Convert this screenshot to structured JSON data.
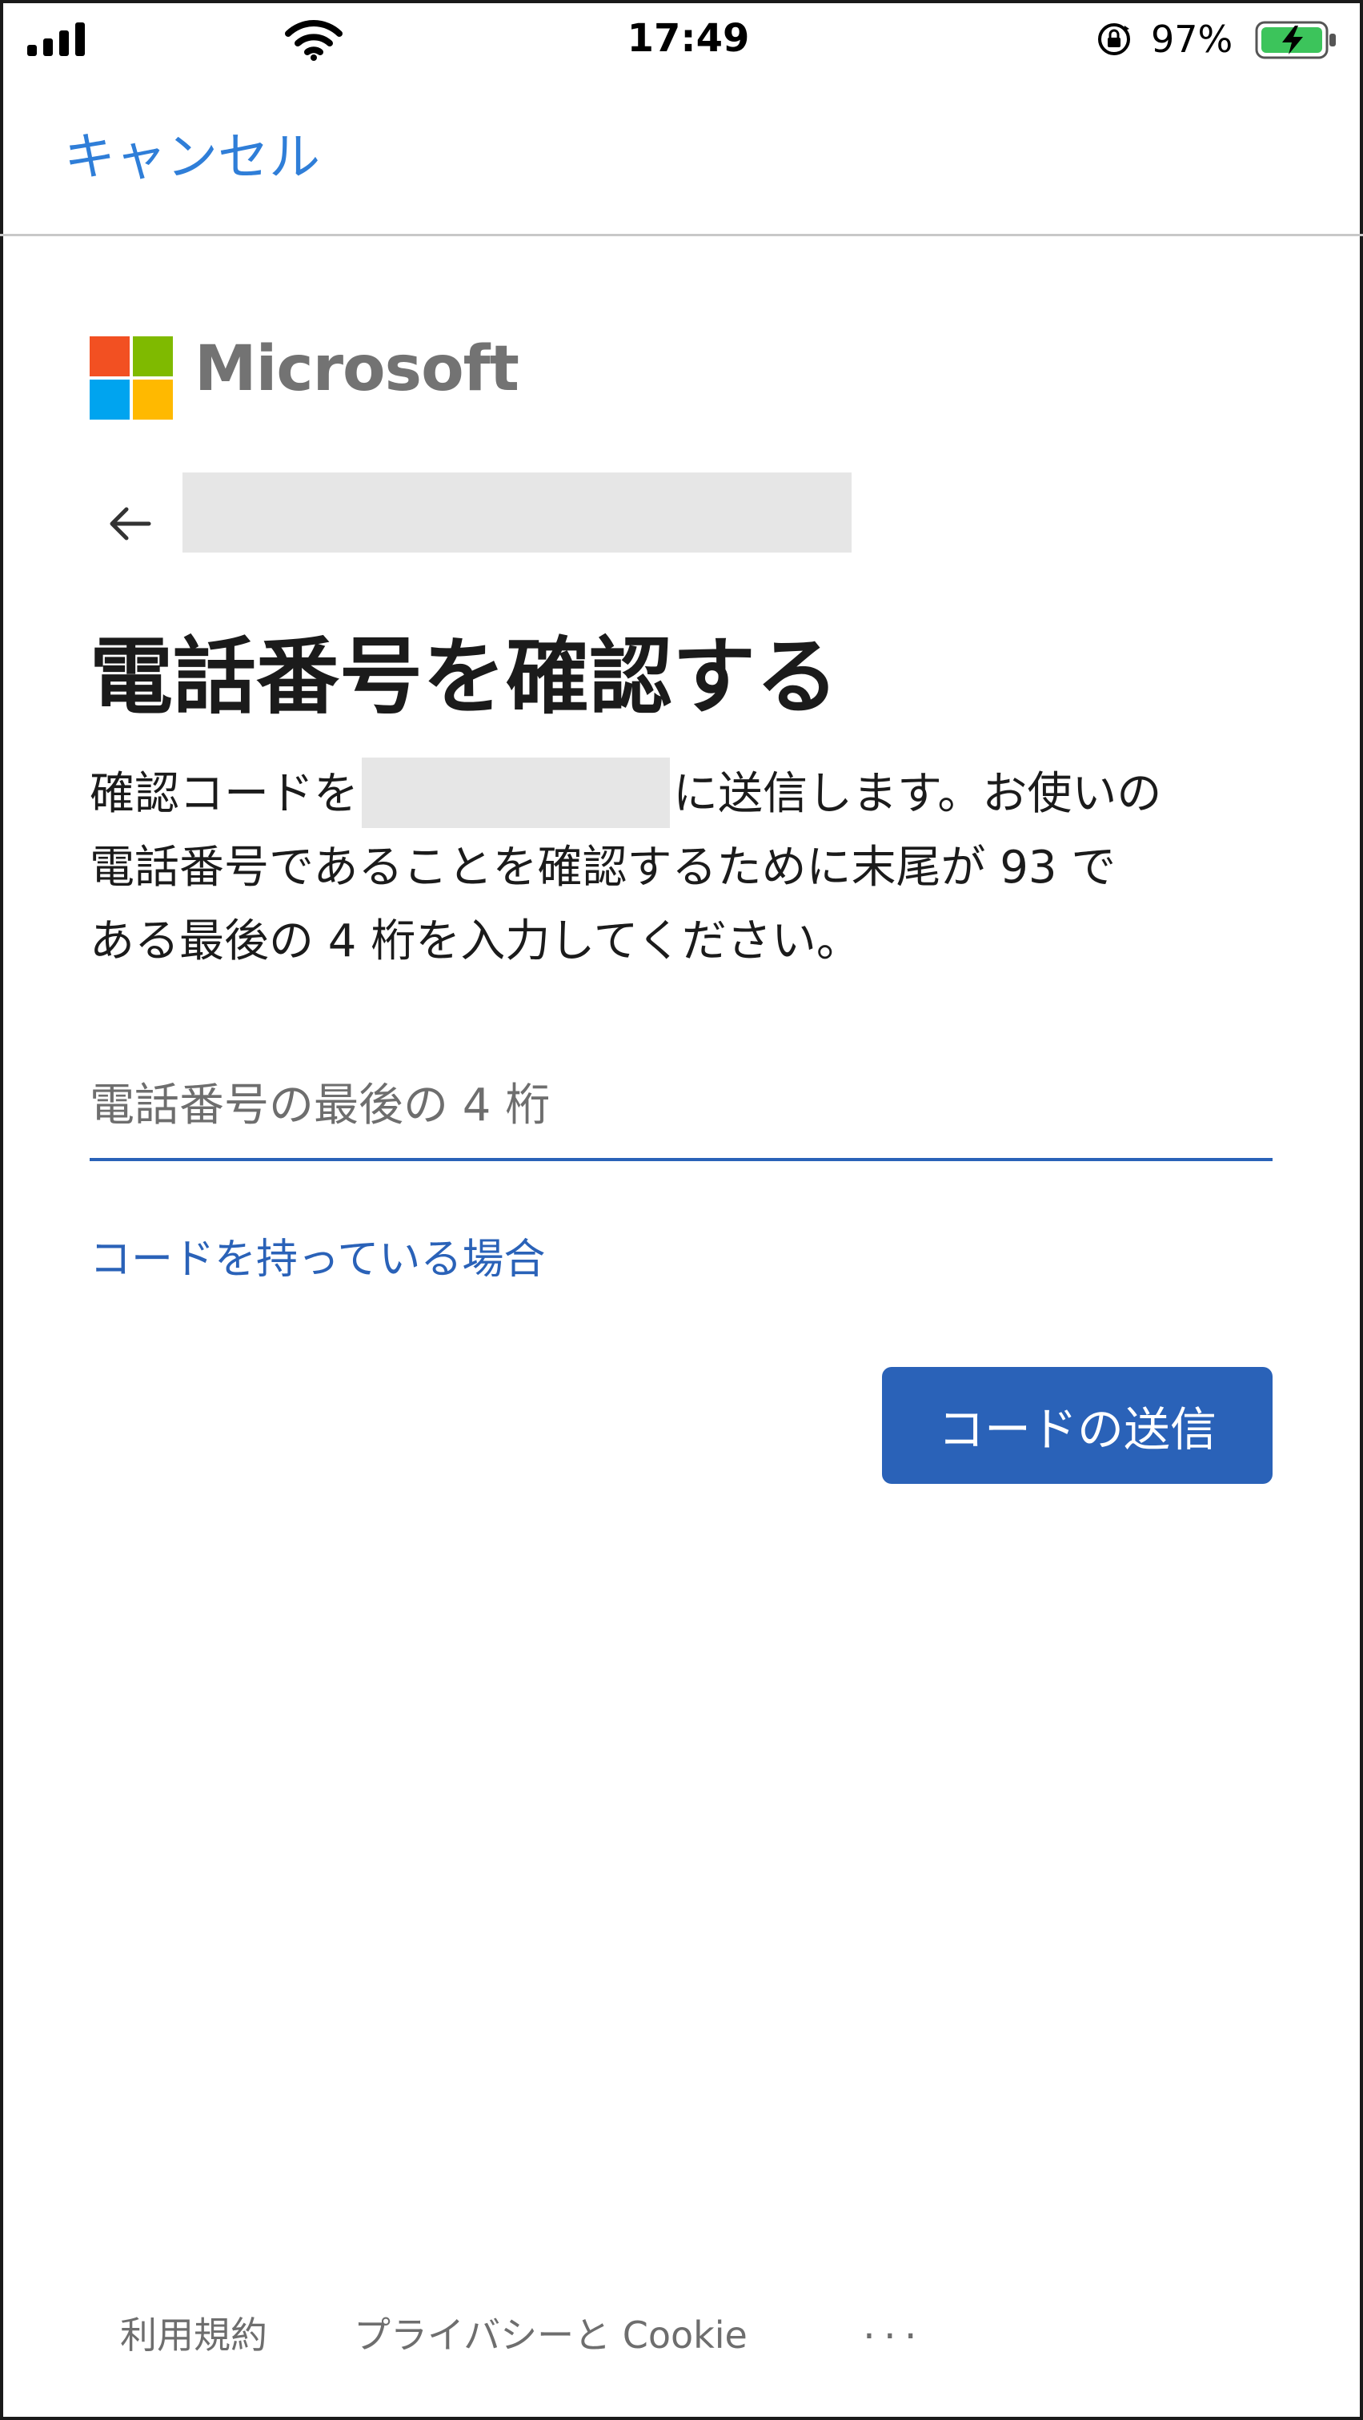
{
  "status_bar": {
    "time": "17:49",
    "battery_percent": "97%",
    "battery_icon": "battery-charging-icon",
    "signal_icon": "cellular-signal-icon",
    "wifi_icon": "wifi-icon",
    "rotation_lock_icon": "rotation-lock-icon"
  },
  "header": {
    "cancel_label": "キャンセル"
  },
  "brand": {
    "name": "Microsoft",
    "logo_colors": [
      "#f25022",
      "#7fba00",
      "#00a4ef",
      "#ffb900"
    ]
  },
  "main": {
    "back_icon": "back-arrow-icon",
    "title": "電話番号を確認する",
    "description": {
      "line1_before": "確認コードを",
      "line1_after": "に送信します。お使いの",
      "line2": "電話番号であることを確認するために末尾が 93 で",
      "line3": "ある最後の 4 桁を入力してください。"
    },
    "input_placeholder": "電話番号の最後の 4 桁",
    "input_value": "",
    "have_code_link": "コードを持っている場合",
    "send_button": "コードの送信"
  },
  "footer": {
    "terms": "利用規約",
    "privacy": "プライバシーと Cookie",
    "more": "..."
  },
  "colors": {
    "accent": "#2a62b8",
    "cancel_text": "#2f7ed8",
    "redaction": "#e6e6e6"
  }
}
